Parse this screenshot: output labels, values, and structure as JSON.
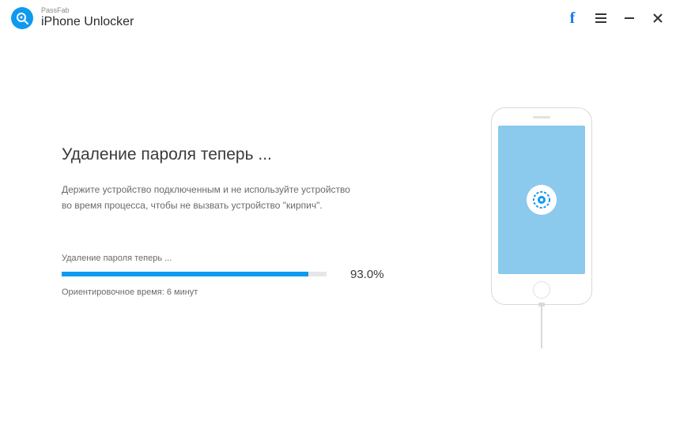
{
  "titlebar": {
    "brand": "PassFab",
    "app_name": "iPhone Unlocker"
  },
  "main": {
    "heading": "Удаление пароля теперь ...",
    "subtext": "Держите устройство подключенным и не используйте устройство во время процесса, чтобы не вызвать устройство \"кирпич\".",
    "progress_label": "Удаление пароля теперь ...",
    "progress_percent": "93.0%",
    "progress_value": 93,
    "eta": "Ориентировочное время: 6 минут"
  },
  "colors": {
    "accent": "#0f9af0",
    "phone_screen": "#8bc9ed"
  }
}
